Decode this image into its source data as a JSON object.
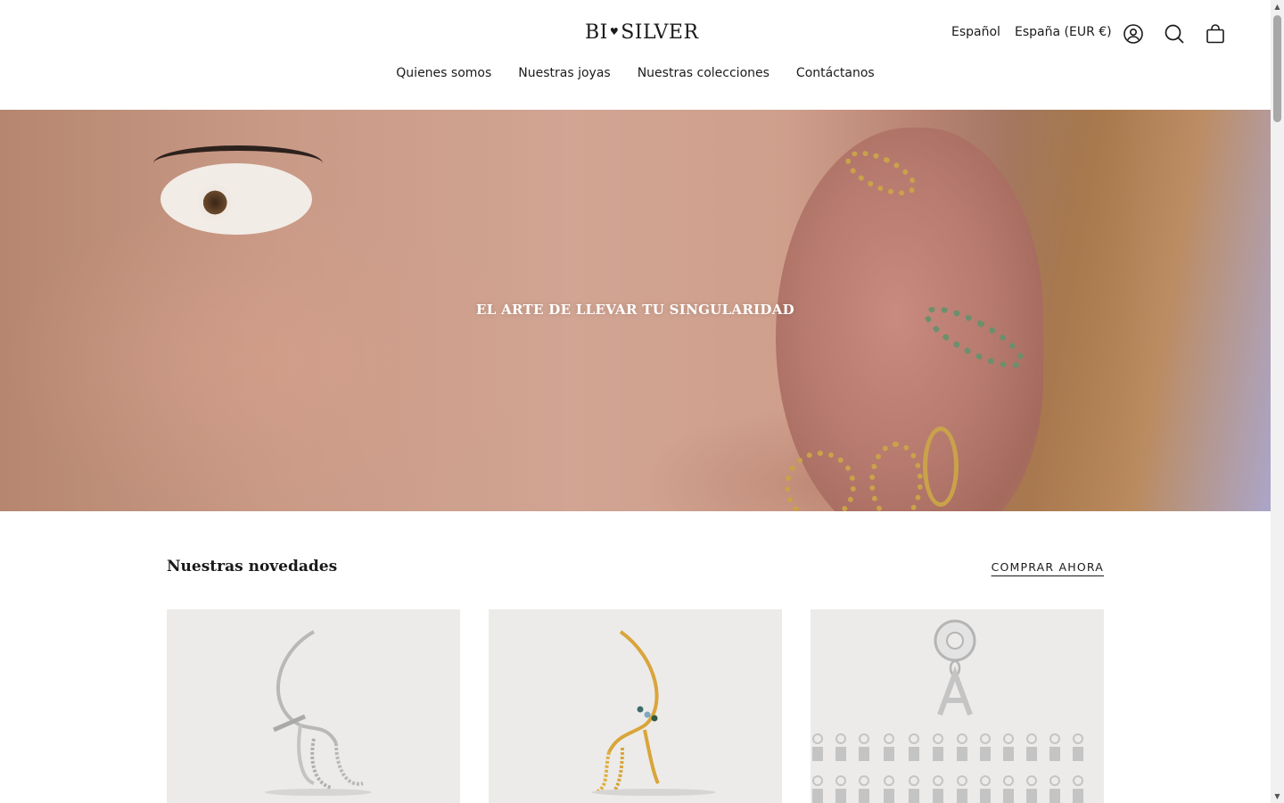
{
  "brand": {
    "logo_left": "BI",
    "logo_heart": "♥",
    "logo_right": "SILVER"
  },
  "header": {
    "language": "Español",
    "country": "España (EUR €)",
    "icons": [
      "account-icon",
      "search-icon",
      "cart-icon"
    ]
  },
  "nav": {
    "items": [
      {
        "label": "Quienes somos"
      },
      {
        "label": "Nuestras joyas"
      },
      {
        "label": "Nuestras colecciones"
      },
      {
        "label": "Contáctanos"
      }
    ]
  },
  "hero": {
    "title": "EL ARTE DE LLEVAR TU SINGULARIDAD"
  },
  "section": {
    "title": "Nuestras novedades",
    "link": "COMPRAR AHORA",
    "products": [
      {
        "image": "silver-ear-cuff-image"
      },
      {
        "image": "gold-ear-cuff-image"
      },
      {
        "image": "silver-letter-charms-image"
      }
    ]
  },
  "colors": {
    "text": "#1a1a1a",
    "card_bg": "#ecebe9",
    "gold": "#c9a24a",
    "silver": "#b8b8b8"
  }
}
